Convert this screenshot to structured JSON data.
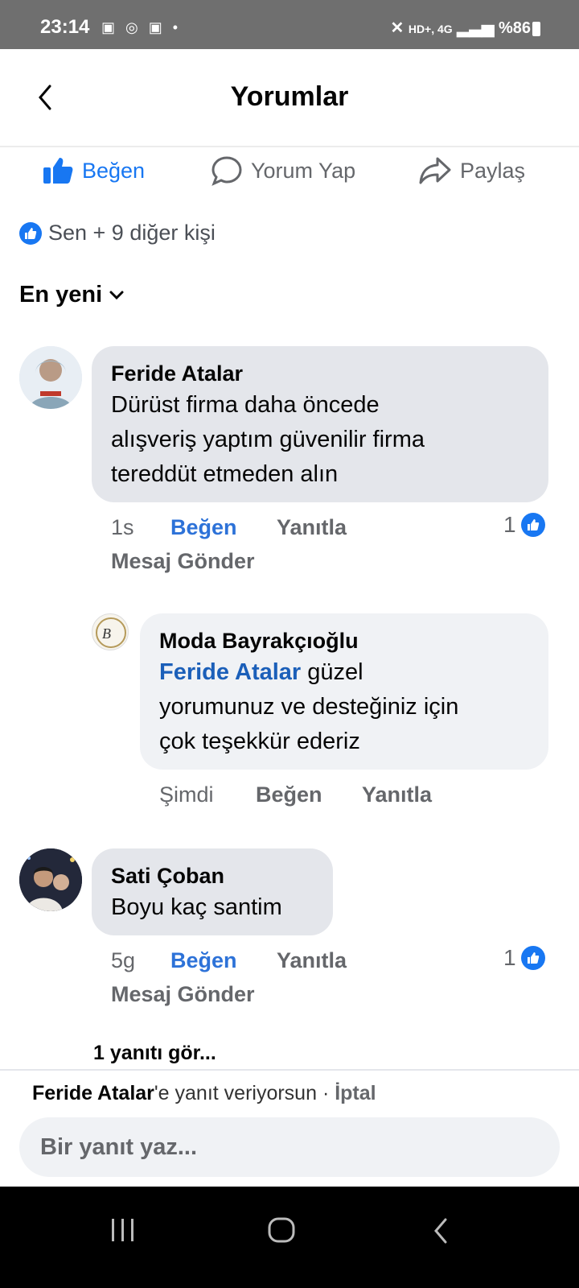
{
  "status_bar": {
    "time": "23:14",
    "left_icons": [
      "box-icon",
      "whatsapp-icon",
      "box-icon",
      "dot-icon"
    ],
    "network": "HD+, 4G",
    "battery": "%86"
  },
  "header": {
    "title": "Yorumlar"
  },
  "actions": {
    "like": "Beğen",
    "comment": "Yorum Yap",
    "share": "Paylaş"
  },
  "reactions": {
    "text": "Sen + 9 diğer kişi"
  },
  "sort": {
    "label": "En yeni"
  },
  "comments": [
    {
      "author": "Feride Atalar",
      "lines": [
        "Dürüst firma daha öncede",
        "alışveriş yaptım güvenilir firma",
        "tereddüt etmeden alın"
      ],
      "time": "1s",
      "like": "Beğen",
      "reply": "Yanıtla",
      "message": "Mesaj Gönder",
      "likes": "1"
    },
    {
      "author": "Moda Bayrakçıoğlu",
      "mention": "Feride Atalar",
      "lines": [
        " güzel",
        "yorumunuz ve desteğiniz için",
        "çok teşekkür ederiz"
      ],
      "time": "Şimdi",
      "like": "Beğen",
      "reply": "Yanıtla"
    },
    {
      "author": "Sati Çoban",
      "lines": [
        "Boyu kaç santim"
      ],
      "time": "5g",
      "like": "Beğen",
      "reply": "Yanıtla",
      "message": "Mesaj Gönder",
      "likes": "1"
    }
  ],
  "more_replies": "1 yanıtı gör...",
  "composer": {
    "replying_name": "Feride Atalar",
    "replying_text": "'e yanıt veriyorsun · ",
    "cancel": "İptal",
    "placeholder": "Bir yanıt yaz..."
  },
  "colors": {
    "accent": "#1877f2",
    "link": "#1b5fb9",
    "bubble": "#e4e6eb",
    "muted": "#65676b"
  }
}
